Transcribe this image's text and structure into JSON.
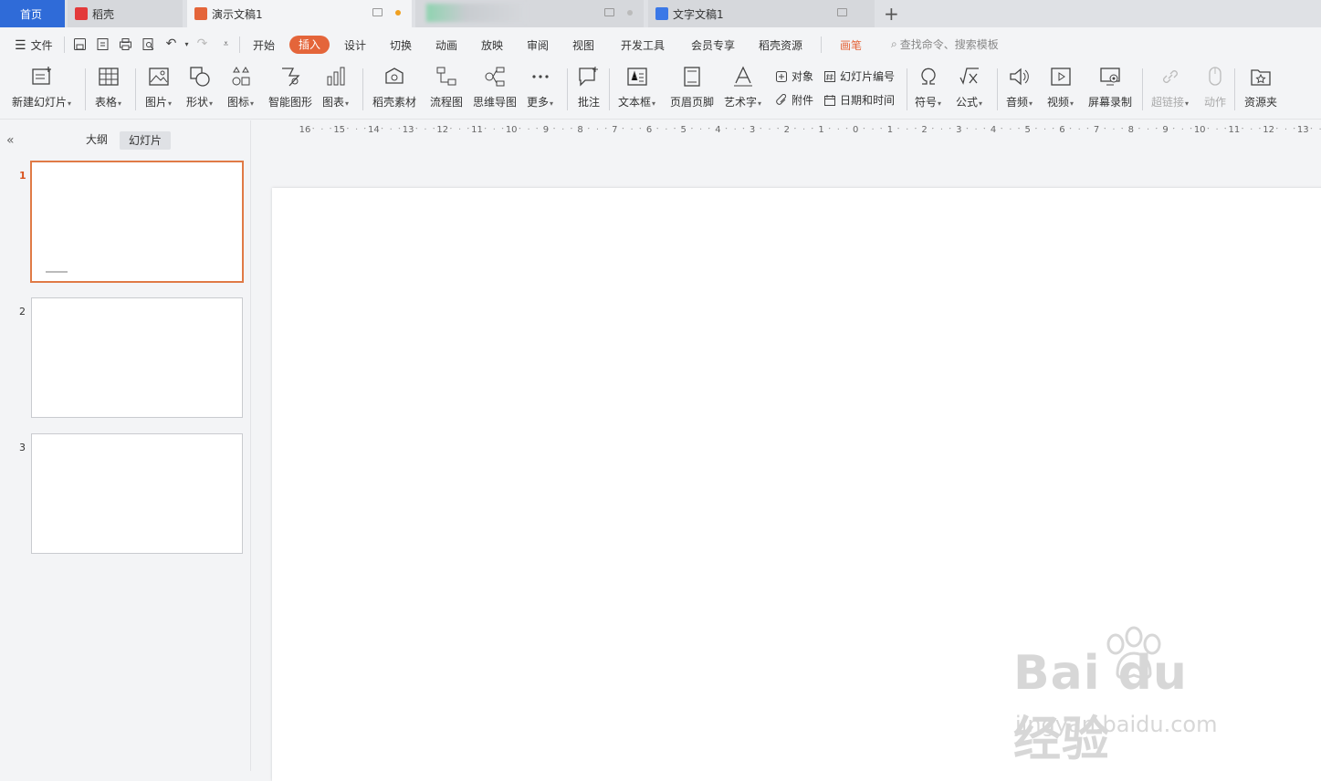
{
  "tabs": {
    "home": "首页",
    "daoke": "稻壳",
    "presentation": "演示文稿1",
    "document": "文字文稿1"
  },
  "menu": {
    "file": "文件",
    "items": [
      "开始",
      "插入",
      "设计",
      "切换",
      "动画",
      "放映",
      "审阅",
      "视图",
      "开发工具",
      "会员专享",
      "稻壳资源"
    ],
    "pen": "画笔",
    "search_placeholder": "查找命令、搜索模板"
  },
  "ribbon": {
    "new_slide": "新建幻灯片",
    "table": "表格",
    "picture": "图片",
    "shape": "形状",
    "icon": "图标",
    "smart_art": "智能图形",
    "chart": "图表",
    "daoke_material": "稻壳素材",
    "flowchart": "流程图",
    "mindmap": "思维导图",
    "more": "更多",
    "comment": "批注",
    "textbox": "文本框",
    "header_footer": "页眉页脚",
    "wordart": "艺术字",
    "object": "对象",
    "attachment": "附件",
    "slide_number": "幻灯片编号",
    "date_time": "日期和时间",
    "symbol": "符号",
    "formula": "公式",
    "audio": "音频",
    "video": "视频",
    "screen_record": "屏幕录制",
    "hyperlink": "超链接",
    "action": "动作",
    "resources": "资源夹"
  },
  "panel": {
    "outline": "大纲",
    "slides": "幻灯片",
    "slide_numbers": [
      "1",
      "2",
      "3"
    ],
    "selected_slide": 1
  },
  "ruler": {
    "ticks": [
      "16",
      "15",
      "14",
      "13",
      "12",
      "11",
      "10",
      "9",
      "8",
      "7",
      "6",
      "5",
      "4",
      "3",
      "2",
      "1",
      "0",
      "1",
      "2",
      "3",
      "4",
      "5",
      "6",
      "7",
      "8",
      "9",
      "10",
      "11",
      "12",
      "13"
    ]
  },
  "watermark": {
    "brand": "Bai du 经验",
    "url": "jingyan.baidu.com"
  },
  "colors": {
    "accent": "#e4653a",
    "home_tab": "#2f6bd8",
    "selected_border": "#e07a46"
  }
}
